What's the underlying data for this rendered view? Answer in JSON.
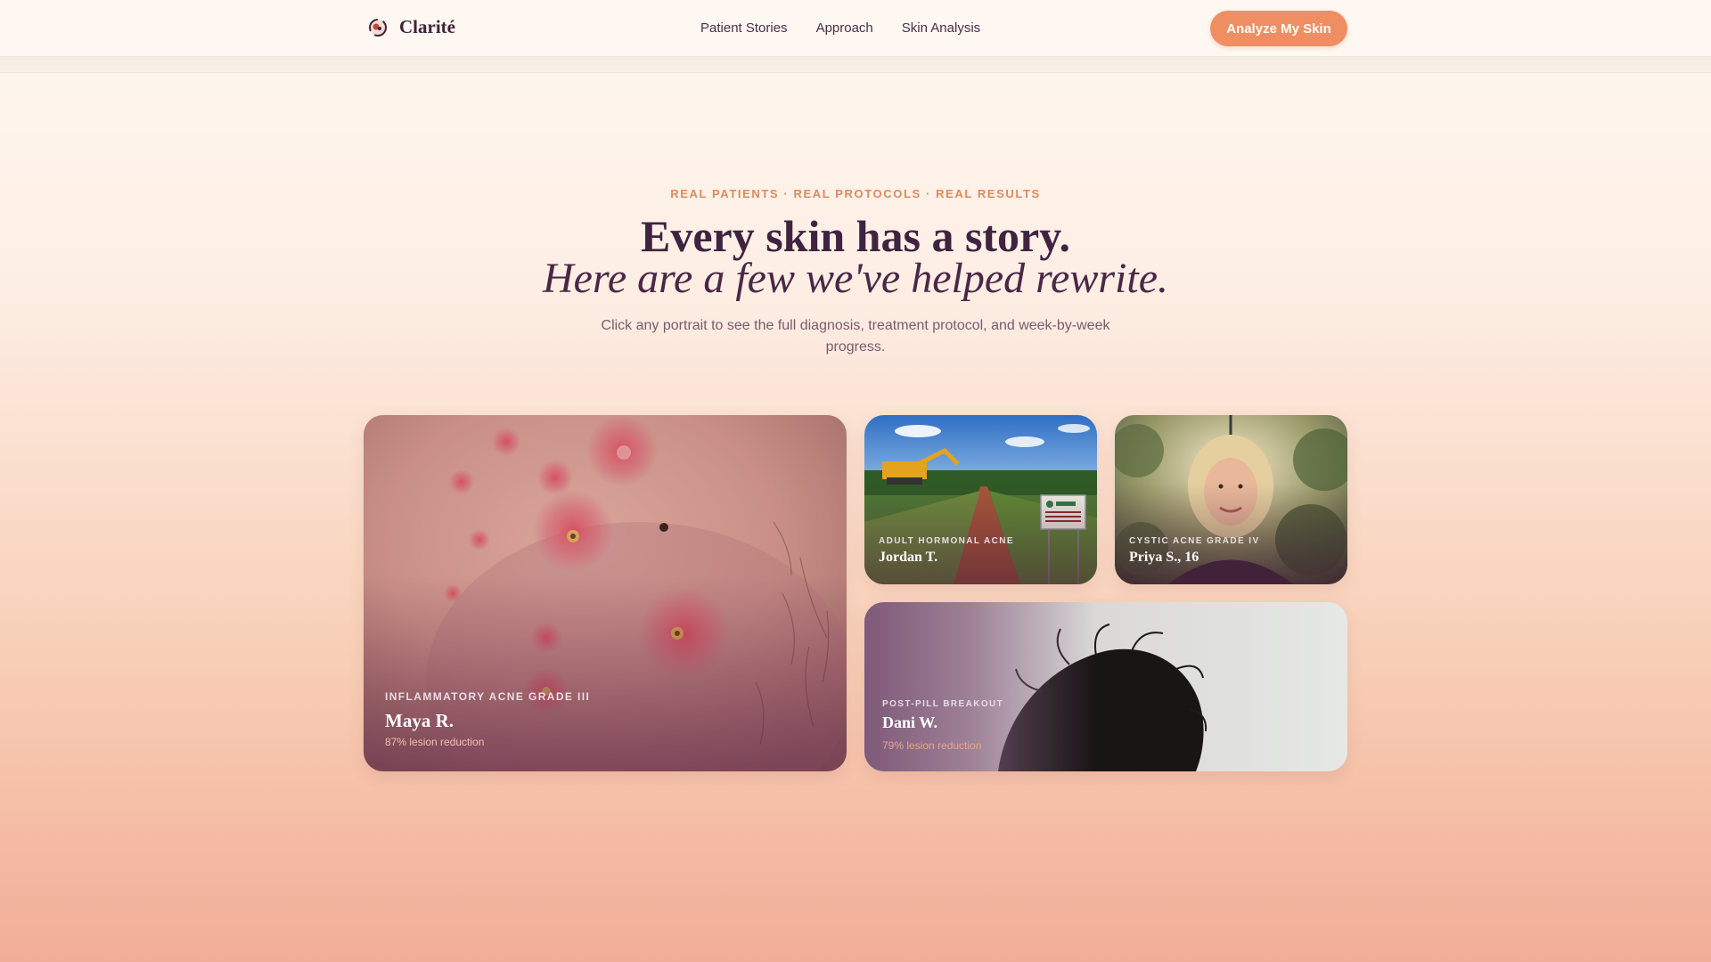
{
  "nav": {
    "brand": "Clarité",
    "logo_icon": "face-swirl-icon",
    "links": [
      "Patient Stories",
      "Approach",
      "Skin Analysis"
    ],
    "cta": "Analyze My Skin"
  },
  "hero": {
    "eyebrow": "REAL PATIENTS · REAL PROTOCOLS · REAL RESULTS",
    "headline_1": "Every skin has a story.",
    "headline_2": "Here are a few we've helped rewrite.",
    "subtitle": "Click any portrait to see the full diagnosis, treatment protocol, and week-by-week progress."
  },
  "stories": [
    {
      "tag": "INFLAMMATORY ACNE GRADE III",
      "name": "Maya R.",
      "stat": "87% lesion reduction"
    },
    {
      "tag": "ADULT HORMONAL ACNE",
      "name": "Jordan T."
    },
    {
      "tag": "CYSTIC ACNE GRADE IV",
      "name": "Priya S., 16"
    },
    {
      "tag": "POST-PILL BREAKOUT",
      "name": "Dani W.",
      "stat": "79% lesion reduction"
    }
  ],
  "colors": {
    "accent": "#ef8e62",
    "ink": "#3f2340",
    "eyebrow": "#e0895c"
  }
}
